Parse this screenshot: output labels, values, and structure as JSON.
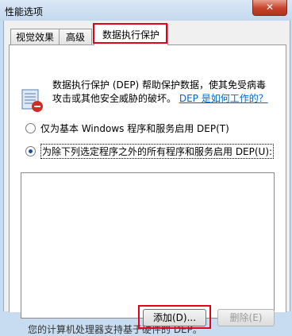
{
  "window": {
    "title": "性能选项",
    "close_label": "✕"
  },
  "tabs": [
    {
      "label": "视觉效果",
      "active": false
    },
    {
      "label": "高级",
      "active": false
    },
    {
      "label": "数据执行保护",
      "active": true
    }
  ],
  "dep": {
    "description": "数据执行保护 (DEP) 帮助保护数据，使其免受病毒攻击或其他安全威胁的破坏。",
    "link": "DEP 是如何工作的？",
    "options": [
      {
        "label": "仅为基本 Windows 程序和服务启用 DEP(T)",
        "selected": false
      },
      {
        "label": "为除下列选定程序之外的所有程序和服务启用 DEP(U):",
        "selected": true
      }
    ],
    "add_button": "添加(D)...",
    "delete_button": "删除(E)",
    "bottom_note": "您的计算机处理器支持基于硬件的 DEP。"
  },
  "highlight_color": "#e2001a"
}
